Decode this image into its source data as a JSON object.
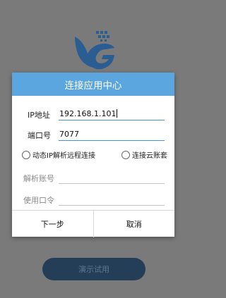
{
  "dialog": {
    "title": "连接应用中心",
    "ip_label": "IP地址",
    "ip_value": "192.168.1.101",
    "port_label": "端口号",
    "port_value": "7077",
    "radio_dynamic_ip": "动态IP解析远程连接",
    "radio_cloud_account": "连接云账套",
    "resolve_account_label": "解析账号",
    "password_label": "使用口令",
    "next_button": "下一步",
    "cancel_button": "取消"
  },
  "trial_button": "演示试用",
  "colors": {
    "dialog_header": "#5ba6df",
    "overlay": "#7a7a7a",
    "trial_button_bg": "#243e57",
    "logo": "#2a5d92"
  },
  "icons": [
    "app-logo-icon",
    "radio-unchecked-icon"
  ]
}
